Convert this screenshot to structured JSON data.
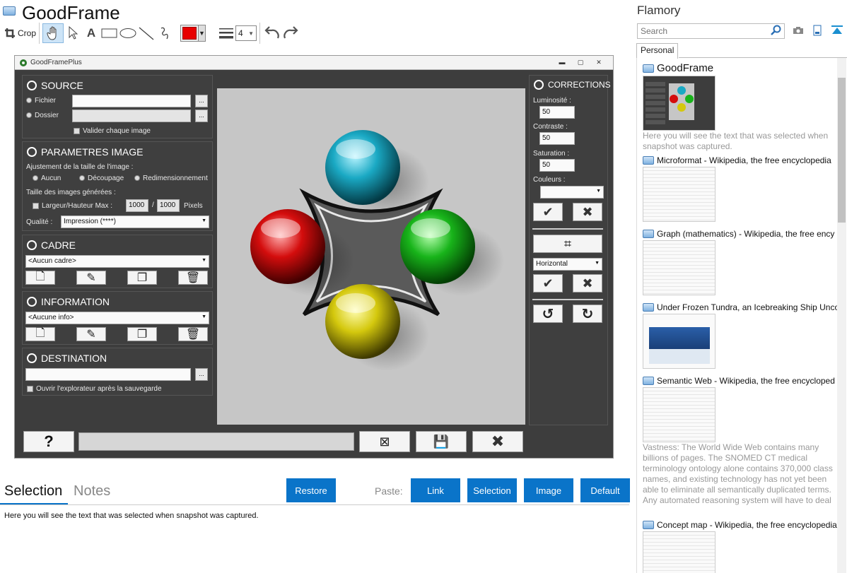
{
  "header": {
    "title": "GoodFrame",
    "crop_label": "Crop",
    "line_width": "4"
  },
  "colors": {
    "accent": "#0a74c9",
    "pen_color": "#e80000"
  },
  "screenshot": {
    "window_title": "GoodFramePlus",
    "source": {
      "heading": "SOURCE",
      "file_label": "Fichier",
      "folder_label": "Dossier",
      "validate_label": "Valider chaque image",
      "browse": "..."
    },
    "params": {
      "heading": "PARAMETRES IMAGE",
      "adjust_label": "Ajustement de la taille de l'image :",
      "opt_none": "Aucun",
      "opt_crop": "Découpage",
      "opt_resize": "Redimensionnement",
      "sizes_label": "Taille des images générées :",
      "maxwh_label": "Largeur/Hauteur Max :",
      "width": "1000",
      "slash": "/",
      "height": "1000",
      "pixels": "Pixels",
      "quality_label": "Qualité :",
      "quality_value": "Impression (****)"
    },
    "frame": {
      "heading": "CADRE",
      "value": "<Aucun cadre>"
    },
    "info": {
      "heading": "INFORMATION",
      "value": "<Aucune info>"
    },
    "dest": {
      "heading": "DESTINATION",
      "open_label": "Ouvrir l'explorateur après la sauvegarde"
    },
    "corrections": {
      "heading": "CORRECTIONS",
      "lum_label": "Luminosité :",
      "lum": "50",
      "con_label": "Contraste :",
      "con": "50",
      "sat_label": "Saturation :",
      "sat": "50",
      "col_label": "Couleurs :",
      "orientation": "Horizontal"
    },
    "help": "?"
  },
  "bottom": {
    "tab_selection": "Selection",
    "tab_notes": "Notes",
    "restore": "Restore",
    "paste_label": "Paste:",
    "paste_link": "Link",
    "paste_selection": "Selection",
    "paste_image": "Image",
    "paste_default": "Default",
    "selection_text": "Here you will see the text that was selected when snapshot was captured."
  },
  "sidebar": {
    "title": "Flamory",
    "search_placeholder": "Search",
    "tab": "Personal",
    "items": [
      {
        "title": "GoodFrame",
        "snippet": "Here you will see the text that was selected when snapshot was captured."
      },
      {
        "title": "Microformat - Wikipedia, the free encyclopedia"
      },
      {
        "title": "Graph (mathematics) - Wikipedia, the free ency"
      },
      {
        "title": "Under Frozen Tundra, an Icebreaking Ship Unco"
      },
      {
        "title": "Semantic Web - Wikipedia, the free encycloped",
        "snippet": "Vastness: The World Wide Web contains many billions of pages. The SNOMED CT medical terminology ontology alone contains 370,000 class names, and existing technology has not yet been able to eliminate all semantically duplicated terms. Any automated reasoning system will have to deal with truly huge inputs."
      },
      {
        "title": "Concept map - Wikipedia, the free encyclopedia"
      }
    ]
  }
}
